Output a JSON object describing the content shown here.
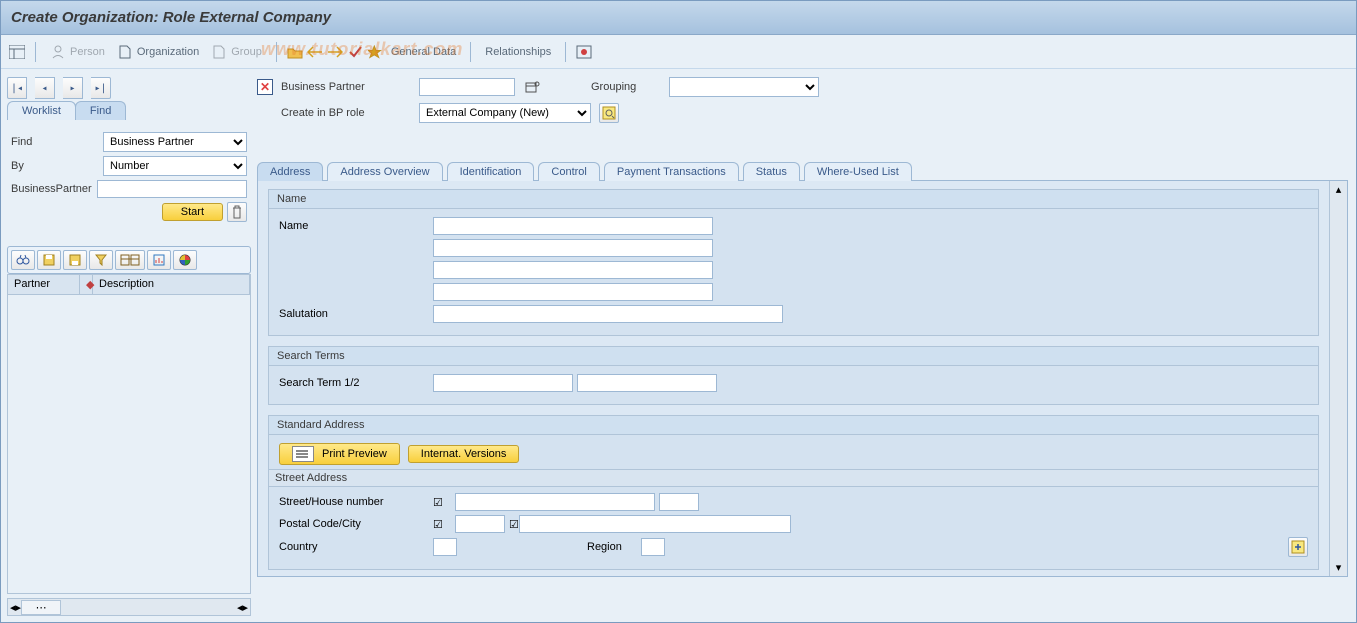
{
  "window": {
    "title": "Create Organization: Role External Company"
  },
  "toolbar": {
    "person": "Person",
    "organization": "Organization",
    "group": "Group",
    "general_data": "General Data",
    "relationships": "Relationships"
  },
  "header": {
    "business_partner_label": "Business Partner",
    "business_partner_value": "",
    "grouping_label": "Grouping",
    "grouping_value": "",
    "create_in_role_label": "Create in BP role",
    "create_in_role_value": "External Company (New)"
  },
  "left": {
    "tabs": {
      "worklist": "Worklist",
      "find": "Find"
    },
    "find_label": "Find",
    "find_value": "Business Partner",
    "by_label": "By",
    "by_value": "Number",
    "bp_label": "BusinessPartner",
    "bp_value": "",
    "start": "Start",
    "grid_cols": {
      "partner": "Partner",
      "description": "Description"
    }
  },
  "right": {
    "tabs": {
      "address": "Address",
      "overview": "Address Overview",
      "identification": "Identification",
      "control": "Control",
      "payment": "Payment Transactions",
      "status": "Status",
      "where_used": "Where-Used List"
    },
    "name_group": "Name",
    "name_label": "Name",
    "salutation_label": "Salutation",
    "search_group": "Search Terms",
    "search_label": "Search Term 1/2",
    "std_address_group": "Standard Address",
    "print_preview": "Print Preview",
    "internat_versions": "Internat. Versions",
    "street_address_head": "Street Address",
    "street_label": "Street/House number",
    "postal_label": "Postal Code/City",
    "country_label": "Country",
    "region_label": "Region",
    "checkbox_glyph": "☑"
  }
}
